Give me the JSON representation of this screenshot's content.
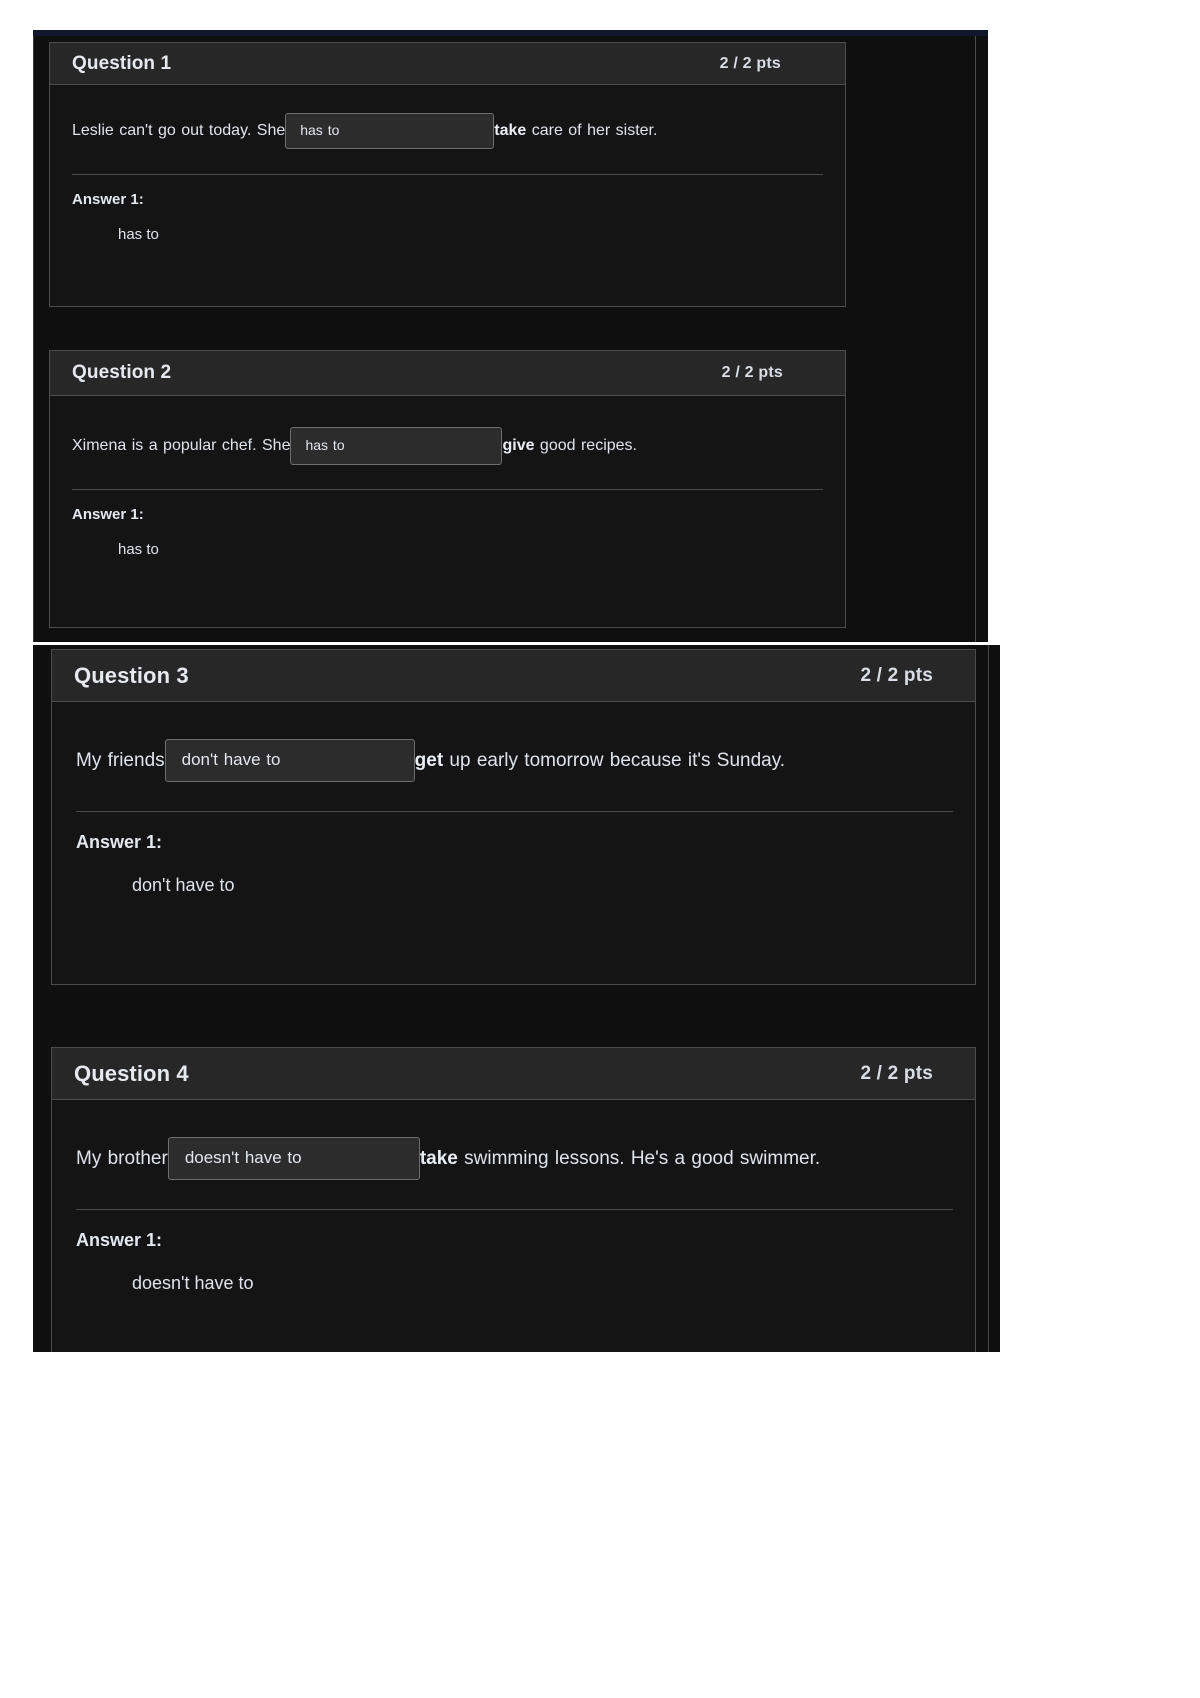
{
  "theme": {
    "page_background": "#ffffff",
    "panel_background": "#0f0f0f",
    "card_background": "#141414",
    "card_header_background": "#272727",
    "card_border": "#4c4c4c",
    "text_color": "#dfe4ec",
    "blank_background": "#2c2c2c",
    "blank_border": "#6e6e6e",
    "top_accent_bar": "#10172c"
  },
  "panels": [
    {
      "name": "upper-screenshot-panel"
    },
    {
      "name": "lower-screenshot-panel"
    }
  ],
  "questions": [
    {
      "title": "Question 1",
      "points": "2 / 2 pts",
      "prompt_before": "Leslie can't go out today. She",
      "blank_value": "has to",
      "prompt_after_bold": "take",
      "prompt_after": " care of her sister.",
      "answer_label": "Answer 1:",
      "answer_value": "has to"
    },
    {
      "title": "Question 2",
      "points": "2 / 2 pts",
      "prompt_before": "Ximena is a popular chef. She",
      "blank_value": "has to",
      "prompt_after_bold": "give",
      "prompt_after": " good recipes.",
      "answer_label": "Answer 1:",
      "answer_value": "has to"
    },
    {
      "title": "Question 3",
      "points": "2 / 2 pts",
      "prompt_before": "My friends",
      "blank_value": "don't have to",
      "prompt_after_bold": "get",
      "prompt_after": " up early tomorrow because it's Sunday.",
      "answer_label": "Answer 1:",
      "answer_value": "don't have to"
    },
    {
      "title": "Question 4",
      "points": "2 / 2 pts",
      "prompt_before": "My brother",
      "blank_value": "doesn't have to",
      "prompt_after_bold": "take",
      "prompt_after": " swimming lessons. He's a good swimmer.",
      "answer_label": "Answer 1:",
      "answer_value": "doesn't have to"
    }
  ]
}
